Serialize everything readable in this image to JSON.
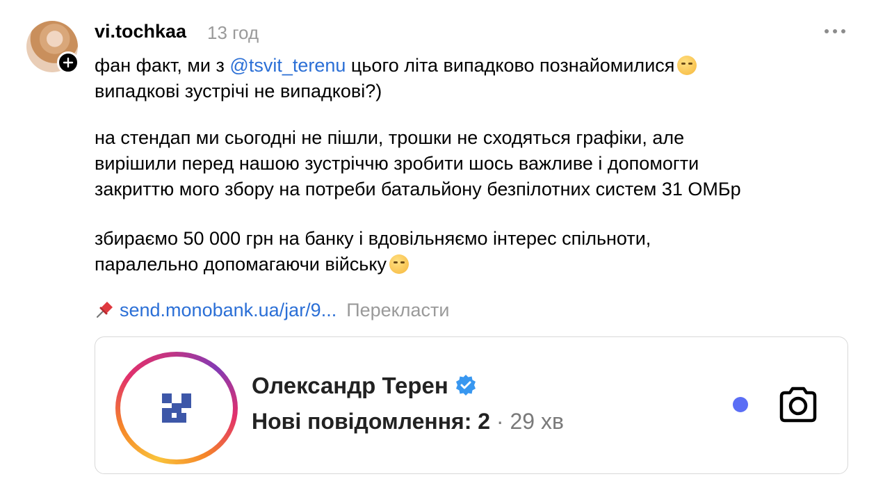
{
  "post": {
    "username": "vi.tochkaa",
    "time": "13 год",
    "paragraph1": {
      "before": "фан факт, ми з ",
      "mention": "@tsvit_terenu",
      "after_line1": " цього літа випадково познайомилися",
      "line2": "випадкові зустрічі не випадкові?)"
    },
    "paragraph2": {
      "line1": "на стендап ми сьогодні не пішли, трошки не сходяться графіки, але",
      "line2": "вирішили перед нашою зустріччю зробити шось важливе і допомогти",
      "line3": "закриттю мого збору на потреби батальйону безпілотних систем 31 ОМБр"
    },
    "paragraph3": {
      "line1": "збираємо 50 000 грн на банку і вдовільняємо інтерес спільноти,",
      "line2": "паралельно допомагаючи війську"
    },
    "link_text": "send.monobank.ua/jar/9...",
    "translate_label": "Перекласти"
  },
  "embedded_card": {
    "name": "Олександр Терен",
    "messages_label": "Нові повідомлення: 2",
    "separator": " · ",
    "ago": "29 хв"
  },
  "icons": {
    "follow": "plus-icon",
    "more": "more-dots-icon",
    "pin": "pushpin-icon",
    "verified": "verified-badge-icon",
    "camera": "camera-icon"
  },
  "colors": {
    "link": "#2b6fd6",
    "muted": "#9a9a9a",
    "verified": "#3897f0",
    "unread_dot": "#5b6ef5"
  }
}
